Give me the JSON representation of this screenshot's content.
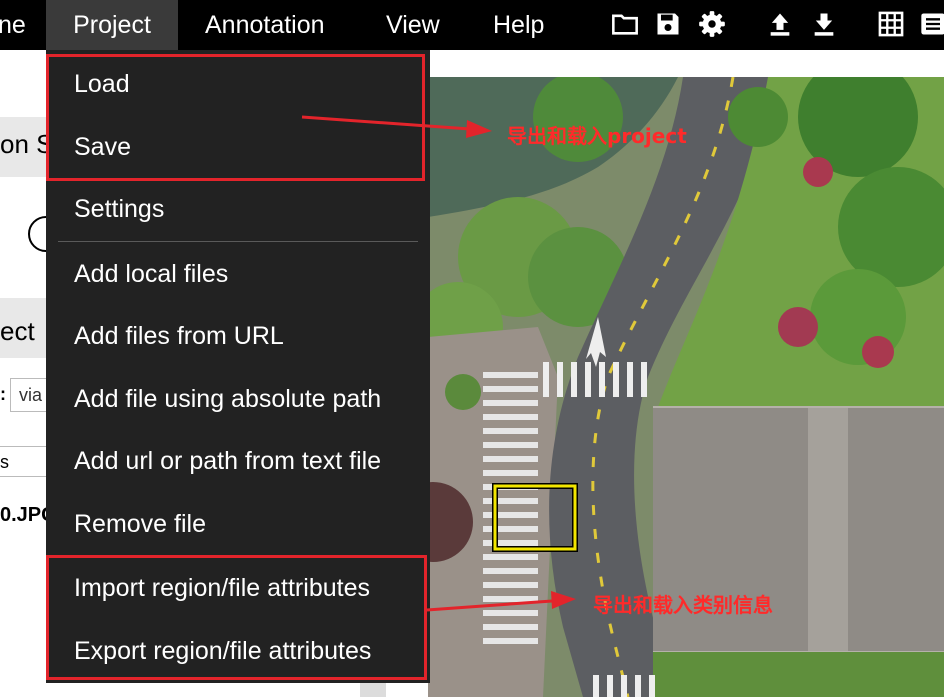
{
  "menubar": {
    "items": [
      {
        "label": "ne"
      },
      {
        "label": "Project"
      },
      {
        "label": "Annotation"
      },
      {
        "label": "View"
      },
      {
        "label": "Help"
      }
    ],
    "icons": [
      "folder-icon",
      "save-icon",
      "gear-icon",
      "upload-icon",
      "download-icon",
      "grid-icon",
      "list-icon"
    ],
    "background": "#000000",
    "active_background": "#3a3a3a"
  },
  "left_panel": {
    "heading_1": "on S",
    "heading_2": "ect",
    "field_label": ":",
    "field_value": "via",
    "list_label": "s",
    "file_label": "0.JPG"
  },
  "project_menu": {
    "items": [
      {
        "label": "Load"
      },
      {
        "label": "Save"
      },
      {
        "label": "Settings"
      },
      {
        "label": "Add local files"
      },
      {
        "label": "Add files from URL"
      },
      {
        "label": "Add file using absolute path"
      },
      {
        "label": "Add url or path from text file"
      },
      {
        "label": "Remove file"
      },
      {
        "label": "Import region/file attributes"
      },
      {
        "label": "Export region/file attributes"
      }
    ],
    "background": "#222222"
  },
  "annotations": {
    "note_project": "导出和载入project",
    "note_attributes": "导出和载入类别信息",
    "color": "#e3242b"
  },
  "canvas": {
    "region_color": "#f2e600"
  }
}
